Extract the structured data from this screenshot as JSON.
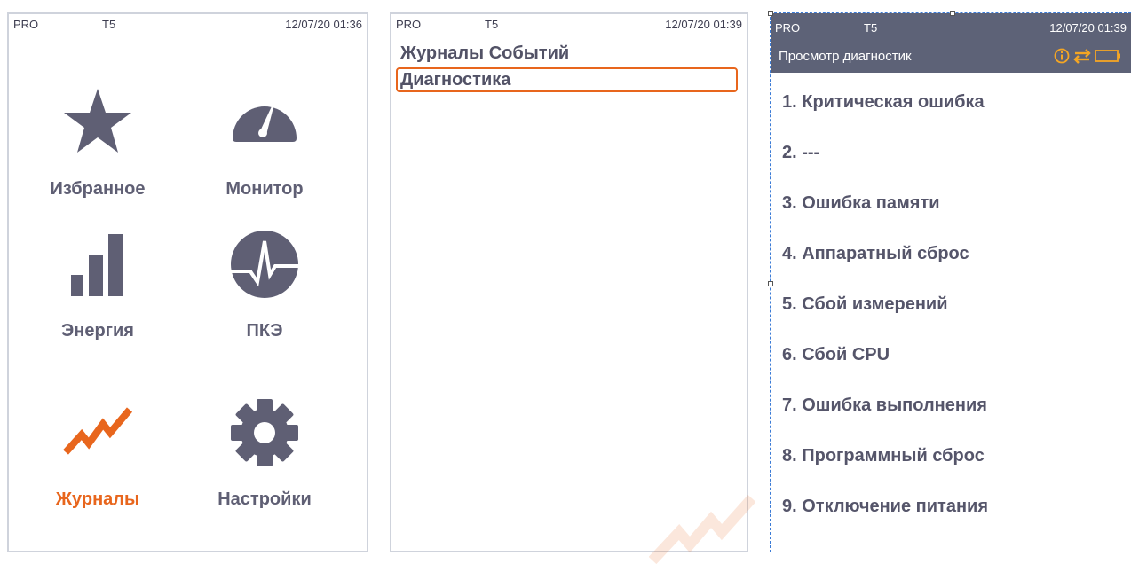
{
  "status_bar": [
    {
      "pro": "PRO",
      "tariff": "T5",
      "datetime": "12/07/20 01:36"
    },
    {
      "pro": "PRO",
      "tariff": "T5",
      "datetime": "12/07/20 01:39"
    },
    {
      "pro": "PRO",
      "tariff": "T5",
      "datetime": "12/07/20 01:39"
    }
  ],
  "main_menu": {
    "tiles": [
      {
        "label": "Избранное",
        "icon": "star-icon"
      },
      {
        "label": "Монитор",
        "icon": "gauge-icon"
      },
      {
        "label": "Энергия",
        "icon": "bar-signal-icon"
      },
      {
        "label": "ПКЭ",
        "icon": "heartbeat-icon"
      },
      {
        "label": "Журналы",
        "icon": "trend-line-icon",
        "active": true
      },
      {
        "label": "Настройки",
        "icon": "gear-icon"
      }
    ]
  },
  "logs_menu": {
    "items": [
      "Журналы Событий",
      "Диагностика"
    ],
    "selected_index": 1
  },
  "diagnostics": {
    "title": "Просмотр диагностик",
    "header_icons": [
      "info-icon",
      "sync-arrows-icon",
      "battery-icon"
    ],
    "items": [
      "1. Критическая ошибка",
      "2. ---",
      "3. Ошибка памяти",
      "4. Аппаратный сброс",
      "5. Сбой измерений",
      "6. Сбой CPU",
      "7. Ошибка выполнения",
      "8. Программный сброс",
      "9. Отключение питания"
    ]
  },
  "colors": {
    "accent": "#e8661d",
    "icon": "#5f5f74",
    "header_bg": "#5d6277"
  }
}
